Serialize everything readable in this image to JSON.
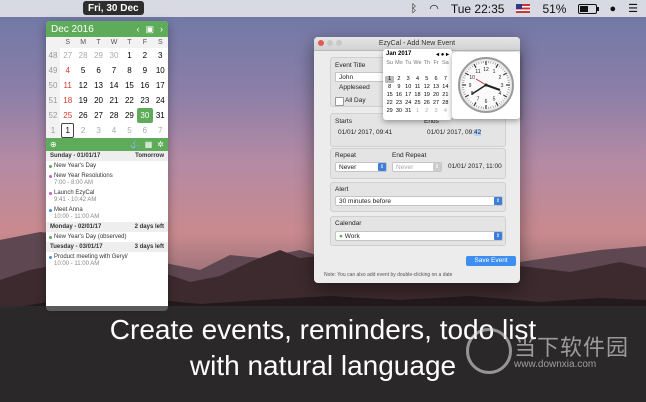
{
  "menubar": {
    "date_badge": "Fri, 30 Dec",
    "time": "Tue 22:35",
    "battery": "51%",
    "battery_fill": 0.51
  },
  "popover": {
    "month_title": "Dec 2016",
    "dow": [
      "S",
      "M",
      "T",
      "W",
      "T",
      "F",
      "S"
    ],
    "weeks": [
      {
        "wk": "48",
        "days": [
          "27",
          "28",
          "29",
          "30",
          "1",
          "2",
          "3"
        ]
      },
      {
        "wk": "49",
        "days": [
          "4",
          "5",
          "6",
          "7",
          "8",
          "9",
          "10"
        ]
      },
      {
        "wk": "50",
        "days": [
          "11",
          "12",
          "13",
          "14",
          "15",
          "16",
          "17"
        ]
      },
      {
        "wk": "51",
        "days": [
          "18",
          "19",
          "20",
          "21",
          "22",
          "23",
          "24"
        ]
      },
      {
        "wk": "52",
        "days": [
          "25",
          "26",
          "27",
          "28",
          "29",
          "30",
          "31"
        ]
      },
      {
        "wk": "1",
        "days": [
          "1",
          "2",
          "3",
          "4",
          "5",
          "6",
          "7"
        ]
      }
    ],
    "toolbar_right": "Tomorrow",
    "events": [
      {
        "header": "Sunday - 01/01/17",
        "badge": "Tomorrow",
        "items": [
          {
            "title": "New Year's Day",
            "time": "",
            "color": "#5eab5a"
          },
          {
            "title": "New Year Resolutions",
            "time": "7:00 - 8:00 AM",
            "color": "#c95cc8"
          },
          {
            "title": "Launch EzyCal",
            "time": "9:41 - 10:42 AM",
            "color": "#c95cc8"
          },
          {
            "title": "Meet Anna",
            "time": "10:00 - 11:00 AM",
            "color": "#4a90d9"
          }
        ]
      },
      {
        "header": "Monday - 02/01/17",
        "badge": "2 days left",
        "items": [
          {
            "title": "New Year's Day (observed)",
            "time": "",
            "color": "#5eab5a"
          }
        ]
      },
      {
        "header": "Tuesday - 03/01/17",
        "badge": "3 days left",
        "items": [
          {
            "title": "Product meeting with Geryi/",
            "time": "10:00 - 11:00 AM",
            "color": "#4a90d9"
          }
        ]
      }
    ]
  },
  "window": {
    "title": "EzyCal - Add New Event",
    "event_title_label": "Event Title",
    "event_title_value": "John Appleseed",
    "all_day_label": "All Day",
    "starts_label": "Starts",
    "starts_value": "01/01/ 2017, 09:41",
    "ends_label": "Ends",
    "ends_value": "01/01/ 2017, 09:",
    "ends_value_sel": "42",
    "repeat_label": "Repeat",
    "repeat_value": "Never",
    "end_repeat_label": "End Repeat",
    "end_repeat_value": "Never",
    "end_repeat_date": "01/01/ 2017, 11:00",
    "alert_label": "Alert",
    "alert_value": "30 minutes before",
    "calendar_label": "Calendar",
    "calendar_value": "Work",
    "save_label": "Save Event",
    "note": "Note: You can also add event by double-clicking on a date"
  },
  "mini_calendar": {
    "title": "Jan 2017",
    "dow": [
      "Su",
      "Mo",
      "Tu",
      "We",
      "Th",
      "Fr",
      "Sa"
    ],
    "days": [
      "",
      "",
      "",
      "",
      "",
      "",
      "",
      "1",
      "2",
      "3",
      "4",
      "5",
      "6",
      "7",
      "8",
      "9",
      "10",
      "11",
      "12",
      "13",
      "14",
      "15",
      "16",
      "17",
      "18",
      "19",
      "20",
      "21",
      "22",
      "23",
      "24",
      "25",
      "26",
      "27",
      "28",
      "29",
      "30",
      "31",
      "1",
      "2",
      "3",
      "4"
    ]
  },
  "caption": {
    "line1": "Create events, reminders, todo list",
    "line2": "with natural language"
  },
  "watermark": {
    "cn": "当下软件园",
    "url": "www.downxia.com"
  }
}
